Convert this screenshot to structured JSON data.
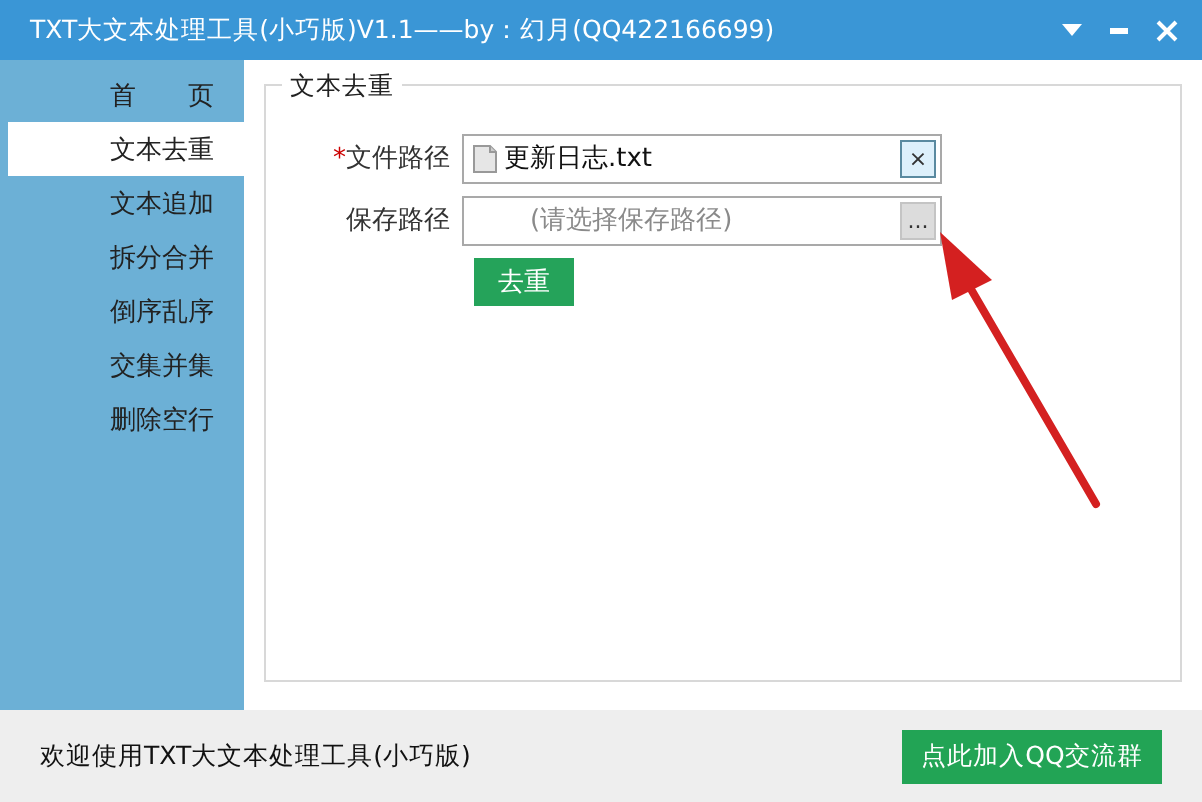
{
  "window": {
    "title": "TXT大文本处理工具(小巧版)V1.1——by：幻月(QQ422166699)"
  },
  "sidebar": {
    "items": [
      {
        "label": "首　　页",
        "selected": false
      },
      {
        "label": "文本去重",
        "selected": true
      },
      {
        "label": "文本追加",
        "selected": false
      },
      {
        "label": "拆分合并",
        "selected": false
      },
      {
        "label": "倒序乱序",
        "selected": false
      },
      {
        "label": "交集并集",
        "selected": false
      },
      {
        "label": "删除空行",
        "selected": false
      }
    ]
  },
  "panel": {
    "title": "文本去重",
    "fields": [
      {
        "label": "文件路径",
        "required_marker": "*",
        "value": "更新日志.txt",
        "button": "×",
        "kind": "file"
      },
      {
        "label": "保存路径",
        "placeholder": "(请选择保存路径)",
        "button": "...",
        "kind": "save"
      }
    ],
    "action": "去重"
  },
  "status_bar": {
    "text": "欢迎使用TXT大文本处理工具(小巧版)",
    "button": "点此加入QQ交流群"
  }
}
